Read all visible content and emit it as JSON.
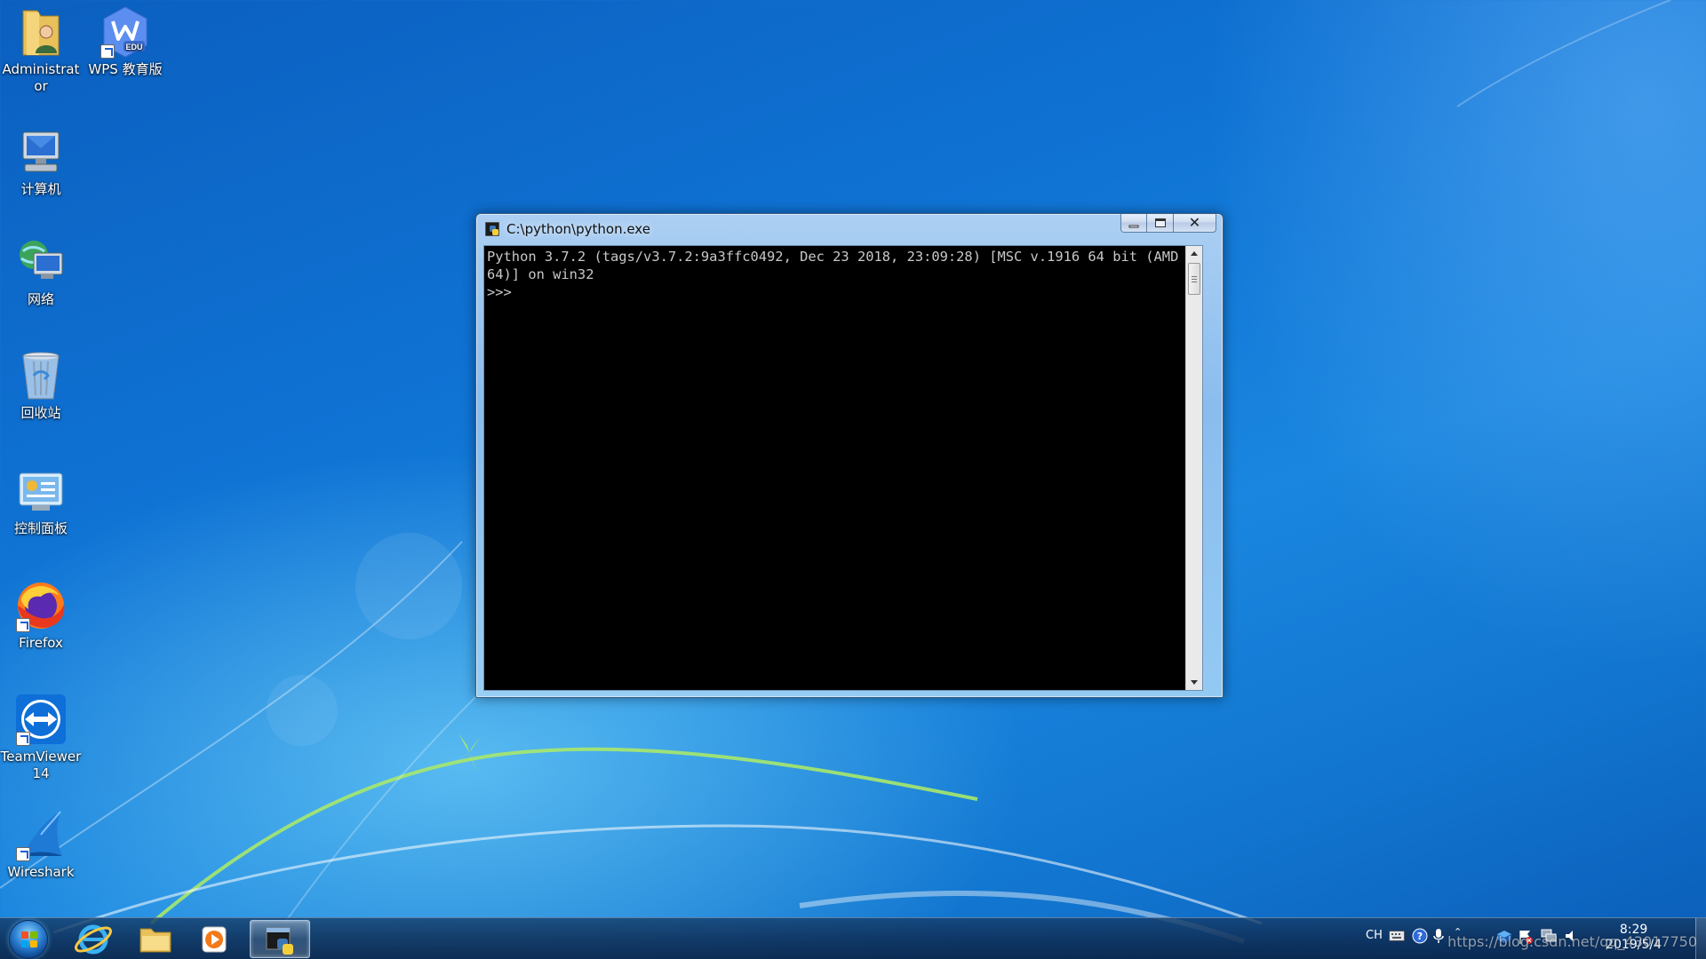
{
  "desktop": {
    "icons": [
      {
        "label": "Administrator",
        "icon": "user-folder-icon"
      },
      {
        "label": "WPS 教育版",
        "icon": "wps-edu-icon",
        "badge": "EDU"
      },
      {
        "label": "计算机",
        "icon": "computer-icon"
      },
      {
        "label": "网络",
        "icon": "network-icon"
      },
      {
        "label": "回收站",
        "icon": "recycle-bin-icon"
      },
      {
        "label": "控制面板",
        "icon": "control-panel-icon"
      },
      {
        "label": "Firefox",
        "icon": "firefox-icon"
      },
      {
        "label": "TeamViewer 14",
        "icon": "teamviewer-icon"
      },
      {
        "label": "Wireshark",
        "icon": "wireshark-icon"
      }
    ]
  },
  "window": {
    "title": "C:\\python\\python.exe",
    "buttons": {
      "minimize": "minimize",
      "maximize": "maximize",
      "close": "close"
    },
    "console_text": "Python 3.7.2 (tags/v3.7.2:9a3ffc0492, Dec 23 2018, 23:09:28) [MSC v.1916 64 bit (AMD64)] on win32\n>>>"
  },
  "taskbar": {
    "pinned": [
      "internet-explorer-icon",
      "file-explorer-icon",
      "media-player-icon",
      "python-console-icon"
    ],
    "tray": {
      "language": "CH",
      "icons": [
        "keyboard-icon",
        "help-icon",
        "microphone-icon",
        "chevron-up-icon",
        "network-shield-icon",
        "flag-alert-icon",
        "network-tray-icon",
        "volume-icon"
      ],
      "time": "8:29",
      "date": "2019/5/4"
    },
    "watermark": "https://blog.csdn.net/qq_43017750"
  },
  "colors": {
    "desktop_blue": "#0f73d4",
    "console_bg": "#000000",
    "console_fg": "#c8c8c8",
    "title_glass": "#a9cdf0"
  }
}
